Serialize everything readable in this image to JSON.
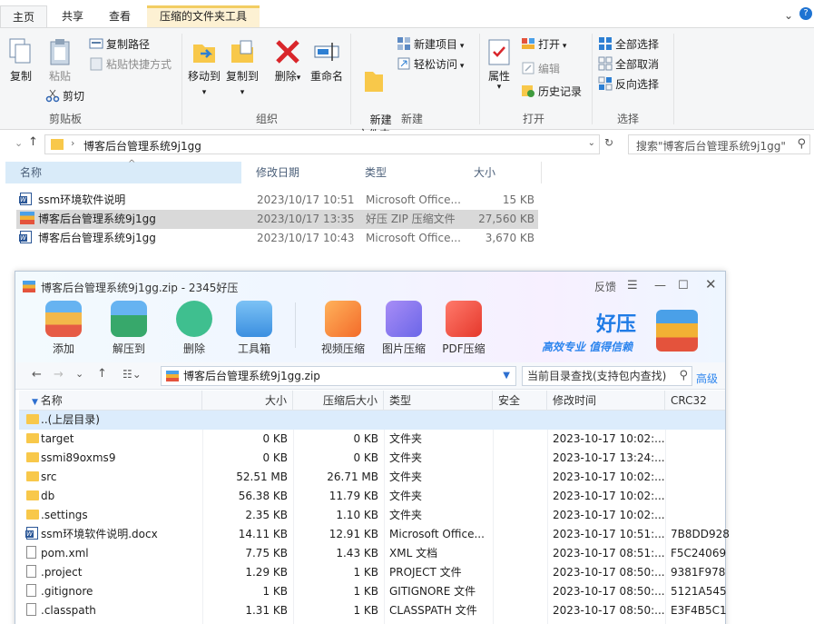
{
  "ribbon_tabs": [
    "主页",
    "共享",
    "查看",
    "压缩的文件夹工具"
  ],
  "clipboard": {
    "copy": "复制",
    "paste": "粘贴",
    "copy_path": "复制路径",
    "paste_shortcut": "粘贴快捷方式",
    "cut": "剪切",
    "label": "剪贴板"
  },
  "organize": {
    "move_to": "移动到",
    "copy_to": "复制到",
    "delete": "删除",
    "rename": "重命名",
    "label": "组织"
  },
  "new_group": {
    "new_folder": "新建\n文件夹",
    "new_item": "新建项目",
    "easy_access": "轻松访问",
    "label": "新建"
  },
  "open_group": {
    "properties": "属性",
    "open": "打开",
    "edit": "编辑",
    "history": "历史记录",
    "label": "打开"
  },
  "select_group": {
    "select_all": "全部选择",
    "select_none": "全部取消",
    "invert": "反向选择",
    "label": "选择"
  },
  "address": {
    "path": "博客后台管理系统9j1gg",
    "search_placeholder": "搜索\"博客后台管理系统9j1gg\""
  },
  "explorer_columns": [
    "名称",
    "修改日期",
    "类型",
    "大小"
  ],
  "explorer_files": [
    {
      "name": "ssm环境软件说明",
      "date": "2023/10/17 10:51",
      "type": "Microsoft Office...",
      "size": "15 KB",
      "icon": "word-icon"
    },
    {
      "name": "博客后台管理系统9j1gg",
      "date": "2023/10/17 13:35",
      "type": "好压 ZIP 压缩文件",
      "size": "27,560 KB",
      "icon": "zip-icon"
    },
    {
      "name": "博客后台管理系统9j1gg",
      "date": "2023/10/17 10:43",
      "type": "Microsoft Office...",
      "size": "3,670 KB",
      "icon": "word-icon"
    }
  ],
  "haozip": {
    "title": "博客后台管理系统9j1gg.zip - 2345好压",
    "feedback": "反馈",
    "tools": [
      "添加",
      "解压到",
      "删除",
      "工具箱",
      "视频压缩",
      "图片压缩",
      "PDF压缩"
    ],
    "brand": "好压",
    "slogan": "高效专业  值得信赖",
    "path": "博客后台管理系统9j1gg.zip",
    "search_placeholder": "当前目录查找(支持包内查找)",
    "advanced": "高级",
    "columns": [
      "名称",
      "大小",
      "压缩后大小",
      "类型",
      "安全",
      "修改时间",
      "CRC32"
    ],
    "rows": [
      {
        "name": "..(上层目录)",
        "size": "",
        "packed": "",
        "type": "",
        "time": "",
        "crc": "",
        "icon": "folder"
      },
      {
        "name": "target",
        "size": "0 KB",
        "packed": "0 KB",
        "type": "文件夹",
        "time": "2023-10-17 10:02:...",
        "crc": "",
        "icon": "folder"
      },
      {
        "name": "ssmi89oxms9",
        "size": "0 KB",
        "packed": "0 KB",
        "type": "文件夹",
        "time": "2023-10-17 13:24:...",
        "crc": "",
        "icon": "folder"
      },
      {
        "name": "src",
        "size": "52.51 MB",
        "packed": "26.71 MB",
        "type": "文件夹",
        "time": "2023-10-17 10:02:...",
        "crc": "",
        "icon": "folder"
      },
      {
        "name": "db",
        "size": "56.38 KB",
        "packed": "11.79 KB",
        "type": "文件夹",
        "time": "2023-10-17 10:02:...",
        "crc": "",
        "icon": "folder"
      },
      {
        "name": ".settings",
        "size": "2.35 KB",
        "packed": "1.10 KB",
        "type": "文件夹",
        "time": "2023-10-17 10:02:...",
        "crc": "",
        "icon": "folder"
      },
      {
        "name": "ssm环境软件说明.docx",
        "size": "14.11 KB",
        "packed": "12.91 KB",
        "type": "Microsoft Office...",
        "time": "2023-10-17 10:51:...",
        "crc": "7B8DD928",
        "icon": "docx"
      },
      {
        "name": "pom.xml",
        "size": "7.75 KB",
        "packed": "1.43 KB",
        "type": "XML 文档",
        "time": "2023-10-17 08:51:...",
        "crc": "F5C24069",
        "icon": "plain"
      },
      {
        "name": ".project",
        "size": "1.29 KB",
        "packed": "1 KB",
        "type": "PROJECT 文件",
        "time": "2023-10-17 08:50:...",
        "crc": "9381F978",
        "icon": "plain"
      },
      {
        "name": ".gitignore",
        "size": "1 KB",
        "packed": "1 KB",
        "type": "GITIGNORE 文件",
        "time": "2023-10-17 08:50:...",
        "crc": "5121A545",
        "icon": "plain"
      },
      {
        "name": ".classpath",
        "size": "1.31 KB",
        "packed": "1 KB",
        "type": "CLASSPATH 文件",
        "time": "2023-10-17 08:50:...",
        "crc": "E3F4B5C1",
        "icon": "plain"
      }
    ]
  }
}
